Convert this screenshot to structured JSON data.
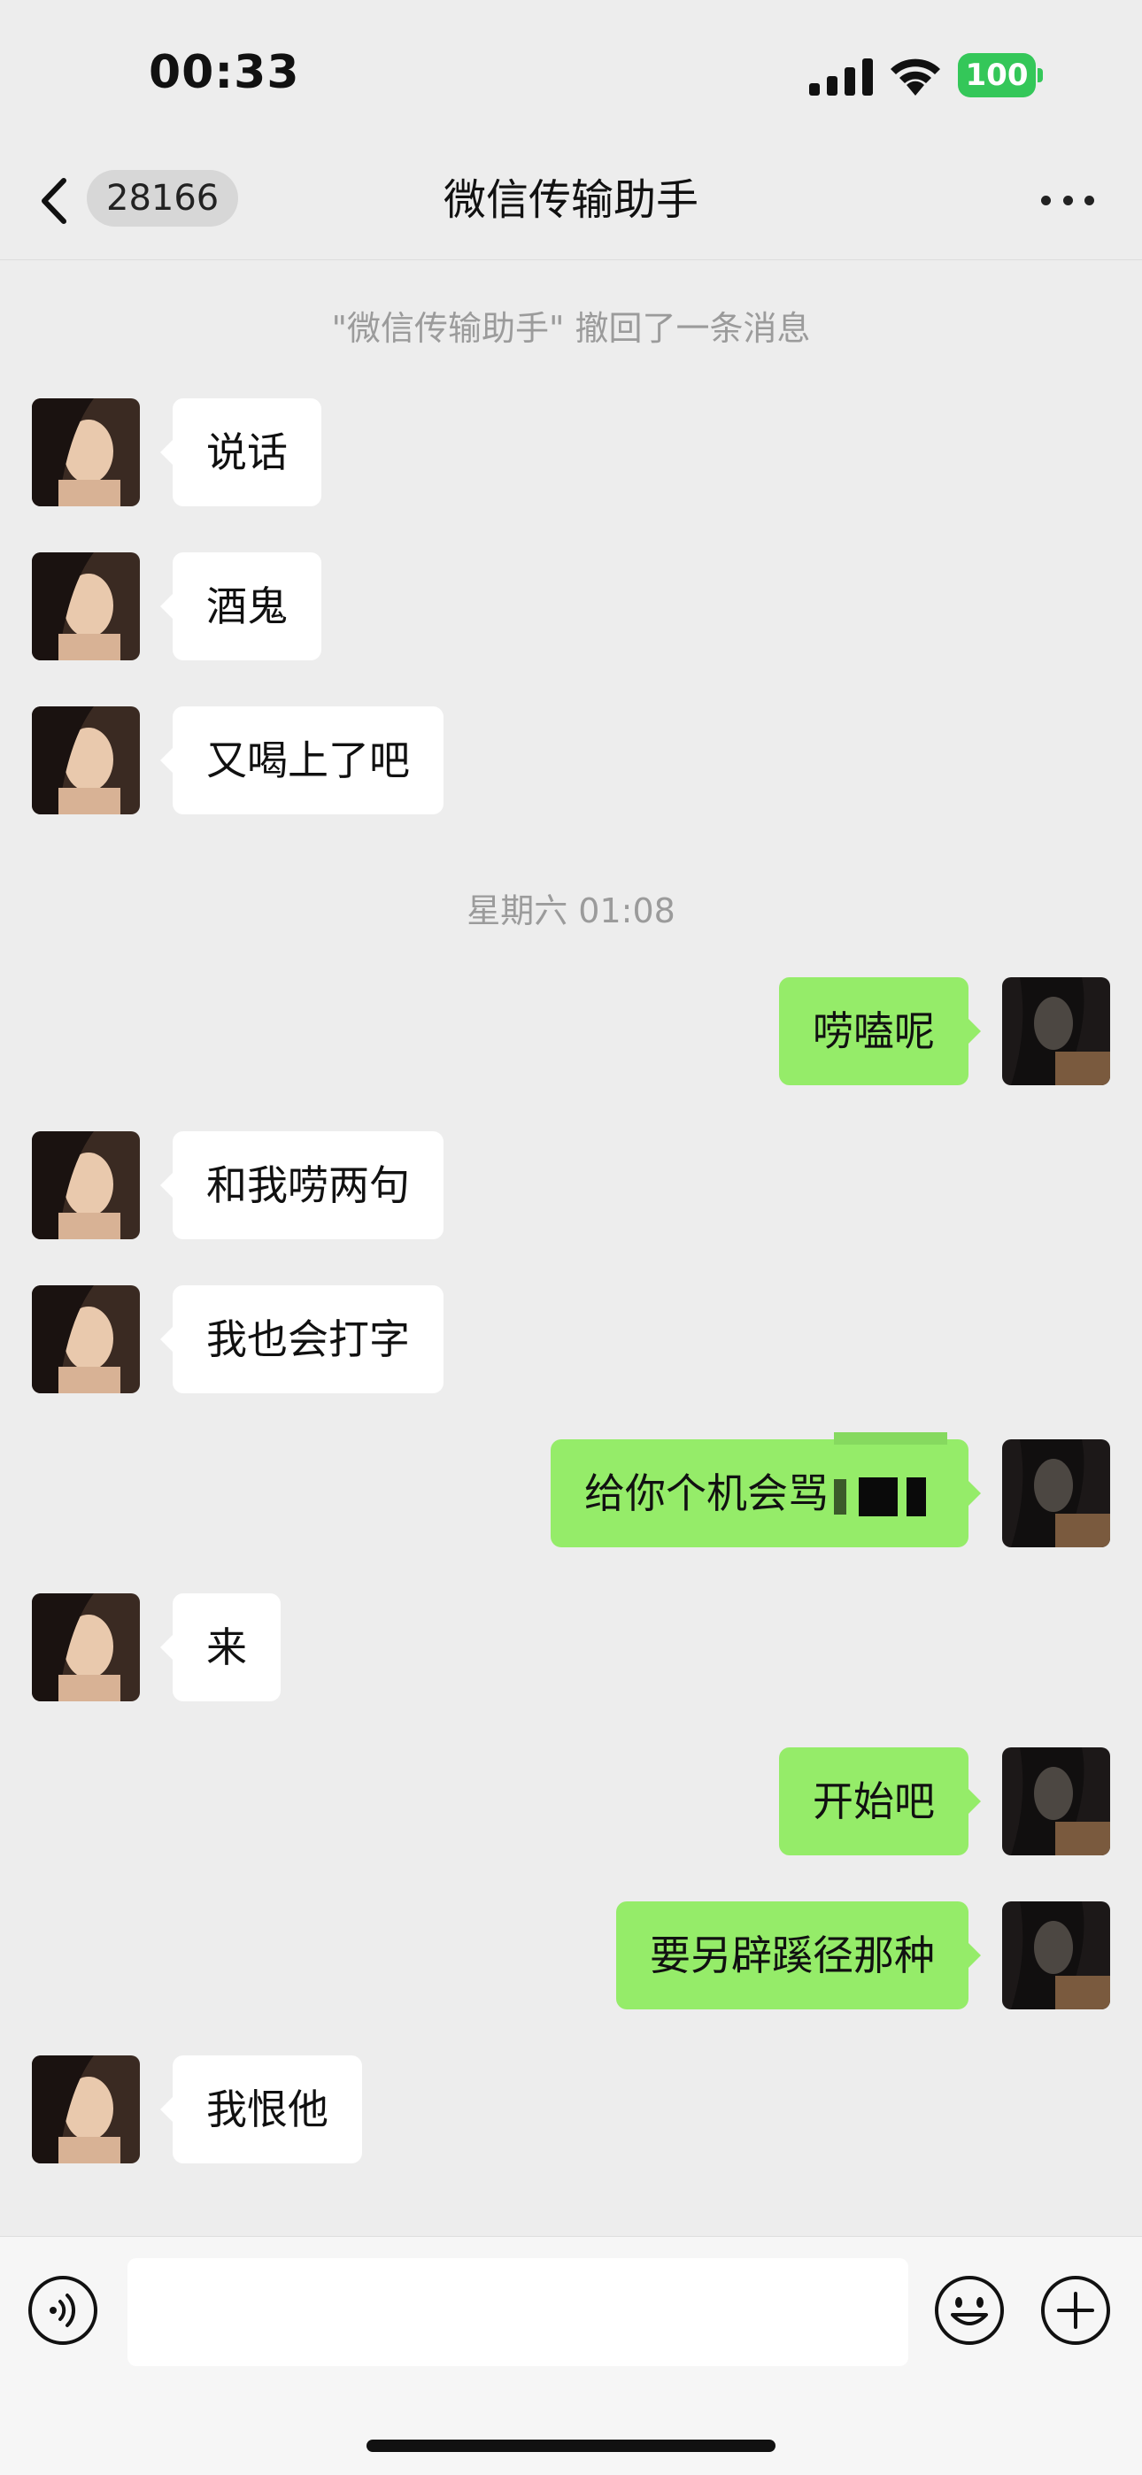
{
  "status_bar": {
    "time": "00:33",
    "battery": "100",
    "battery_color": "#34c759"
  },
  "header": {
    "back_count": "28166",
    "title": "微信传输助手",
    "back_icon": "chevron-left-icon",
    "more_icon": "more-dots-icon"
  },
  "system": {
    "recall_notice": "\"微信传输助手\" 撤回了一条消息",
    "timestamp": "星期六 01:08"
  },
  "messages": [
    {
      "side": "left",
      "text": "说话"
    },
    {
      "side": "left",
      "text": "酒鬼"
    },
    {
      "side": "left",
      "text": "又喝上了吧"
    },
    {
      "side": "right",
      "text": "唠嗑呢"
    },
    {
      "side": "left",
      "text": "和我唠两句"
    },
    {
      "side": "left",
      "text": "我也会打字"
    },
    {
      "side": "right",
      "text": "给你个机会骂"
    },
    {
      "side": "left",
      "text": "来"
    },
    {
      "side": "right",
      "text": "开始吧"
    },
    {
      "side": "right",
      "text": "要另辟蹊径那种"
    },
    {
      "side": "left",
      "text": "我恨他"
    }
  ],
  "input_bar": {
    "placeholder": "",
    "voice_icon": "voice-icon",
    "emoji_icon": "emoji-icon",
    "plus_icon": "plus-icon"
  },
  "colors": {
    "background": "#ededed",
    "bubble_self": "#95ec69",
    "bubble_other": "#ffffff"
  }
}
